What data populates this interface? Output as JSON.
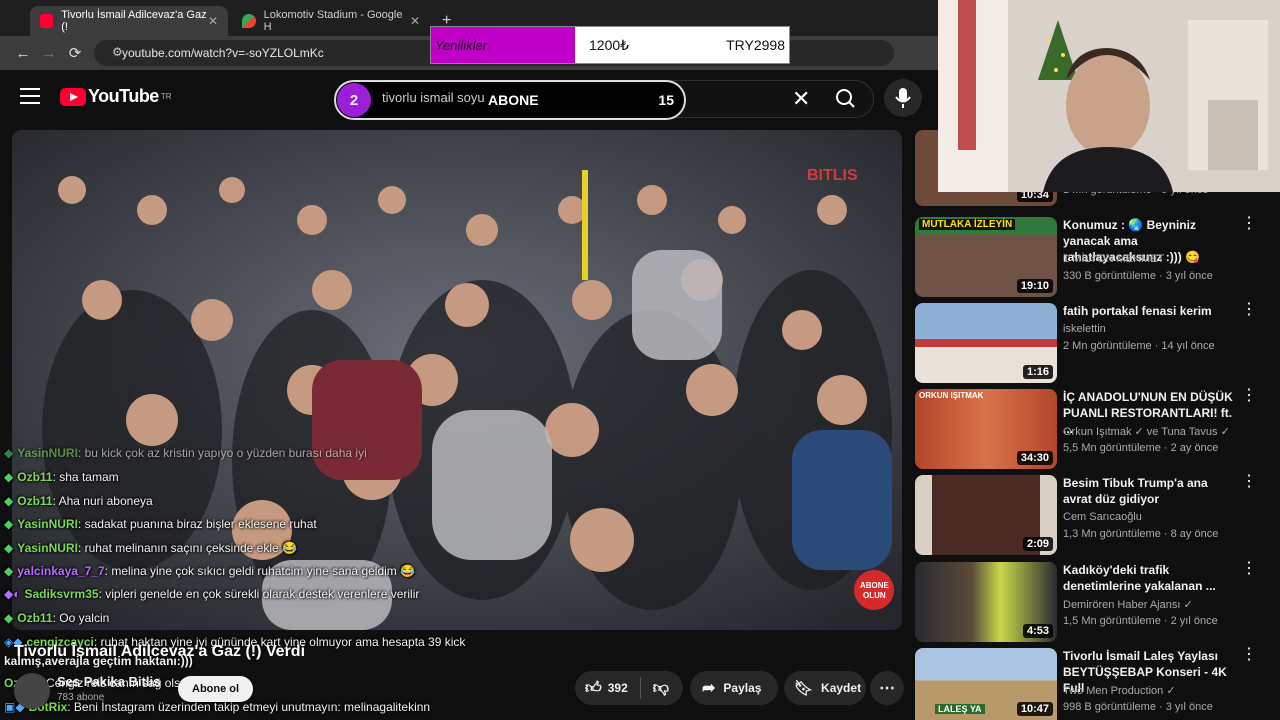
{
  "browser": {
    "tabs": [
      {
        "label": "Tivorlu İsmail Adilcevaz'a Gaz (!"
      },
      {
        "label": "Lokomotiv Stadium - Google H"
      }
    ],
    "new_tab": "+",
    "url": "youtube.com/watch?v=-soYZLOLmKc"
  },
  "youtube": {
    "logo_text": "YouTube",
    "region": "TR",
    "search_query": "tivorlu ismail soyu",
    "clear": "✕"
  },
  "overlay": {
    "donation_label": "Yenilikler",
    "donation_amount": "1200₺",
    "donation_currency": "TRY2998",
    "sub_goal_number": "2",
    "sub_goal_label": "ABONE",
    "sub_goal_count": "15",
    "video_badge": "BITLIS",
    "abone_badge": "ABONE OLUN"
  },
  "video": {
    "title": "Tivorlu İsmail Adilcevaz'a Gaz (!) Verdi",
    "channel": "Ses Pakika Bitlis",
    "subscribers": "783 abone",
    "subscribe_label": "Abone ol",
    "likes": "392",
    "share_label": "Paylaş",
    "save_label": "Kaydet"
  },
  "chat": [
    {
      "user": "YasinNURI",
      "color": "#7cd95a",
      "text": ": bu kick çok az kristin yapıyo o yüzden burası daha iyi"
    },
    {
      "user": "Ozb11",
      "color": "#7cd95a",
      "text": ": sha tamam"
    },
    {
      "user": "Ozb11",
      "color": "#7cd95a",
      "text": ": Aha nuri aboneya"
    },
    {
      "user": "YasinNURI",
      "color": "#7cd95a",
      "text": ": sadakat puanına biraz bişler eklesene ruhat"
    },
    {
      "user": "YasinNURI",
      "color": "#7cd95a",
      "text": ": ruhat melinanın saçını çeksinde ekle 😂"
    },
    {
      "user": "yalcinkaya_7_7",
      "color": "#b96cff",
      "text": ": melina yine çok sıkıcı geldi ruhatcim yine sana geldim 😂"
    },
    {
      "user": "Sadiksvrm35",
      "color": "#7cd95a",
      "text": ": vipleri genelde en çok sürekli olarak destek verenlere verilir"
    },
    {
      "user": "Ozb11",
      "color": "#7cd95a",
      "text": ": Oo yalcin"
    },
    {
      "user": "cengizcayci",
      "color": "#7cd95a",
      "text": ": ruhat haktan yine iyi gününde kart yine olmuyor ama hesapta 39 kick"
    },
    {
      "user": "",
      "color": "#ffffff",
      "text": "kalmış,averajla geçtim haktanı:)))"
    },
    {
      "user": "Ozb11",
      "color": "#7cd95a",
      "text": ": Cengiz reis canın sağ olsun"
    },
    {
      "user": "BotRix",
      "color": "#7cd95a",
      "text": ": Beni İnstagram üzerinden takip etmeyi unutmayın: melinagalitekinn"
    }
  ],
  "recommendations": [
    {
      "title": "Konumuz : 🌏 Beyniniz yanacak ama rahatlayacaksınız :))) 😋",
      "channel": "1 MİLYON MEHMET",
      "meta": "330 B görüntüleme · 3 yıl önce",
      "duration": "19:10",
      "thumb_color": "#2b6a35",
      "thumb_text": "MUTLAKA İZLEYİN"
    },
    {
      "title": "fatih portakal fenasi kerim",
      "channel": "iskelettin",
      "meta": "2 Mn görüntüleme · 14 yıl önce",
      "duration": "1:16",
      "thumb_color": "#6d8fb5",
      "thumb_text": ""
    },
    {
      "title": "İÇ ANADOLU'NUN EN DÜŞÜK PUANLI RESTORANTLARI! ft. ...",
      "channel": "Orkun Işıtmak ✓ ve Tuna Tavus ✓",
      "meta": "5,5 Mn görüntüleme · 2 ay önce",
      "duration": "34:30",
      "thumb_color": "#b3452a",
      "thumb_text": "ORKUN IŞITMAK"
    },
    {
      "title": "Besim Tibuk Trump'a ana avrat düz gidiyor",
      "channel": "Cem Sarıcaoğlu",
      "meta": "1,3 Mn görüntüleme · 8 ay önce",
      "duration": "2:09",
      "thumb_color": "#5a3628",
      "thumb_text": ""
    },
    {
      "title": "Kadıköy'deki trafik denetimlerine yakalanan ...",
      "channel": "Demirören Haber Ajansı ✓",
      "meta": "1,5 Mn görüntüleme · 2 yıl önce",
      "duration": "4:53",
      "thumb_color": "#3a3a3a",
      "thumb_text": ""
    },
    {
      "title": "Tivorlu İsmail Laleş Yaylası BEYTÜŞŞEBAP Konseri - 4K Full",
      "channel": "Two Men Production ✓",
      "meta": "998 B görüntüleme · 3 yıl önce",
      "duration": "10:47",
      "thumb_color": "#8da9c4",
      "thumb_text": "LALEŞ YA"
    }
  ],
  "partial_top": {
    "duration": "10:34",
    "meta": "1 Mn görüntüleme · 9 yıl önce"
  }
}
